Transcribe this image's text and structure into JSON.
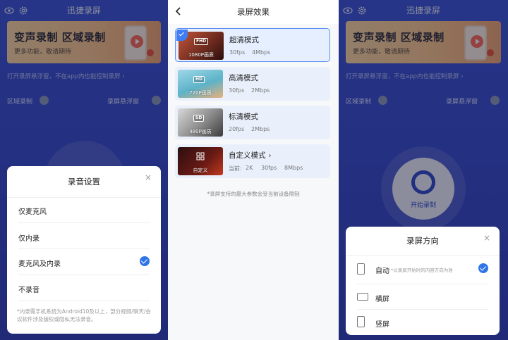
{
  "app": {
    "title": "迅捷录屏",
    "banner_title": "变声录制 区域录制",
    "banner_sub": "更多功能，敬请期待",
    "float_hint": "打开录屏悬浮窗，不在app内也能控制录屏 ›",
    "area_record_label": "区域录制",
    "float_window_label": "录屏悬浮窗",
    "start_record_label": "开始录制"
  },
  "audio_sheet": {
    "title": "录音设置",
    "options": [
      {
        "label": "仅麦克风",
        "selected": false
      },
      {
        "label": "仅内录",
        "selected": false
      },
      {
        "label": "麦克风及内录",
        "selected": true
      },
      {
        "label": "不录音",
        "selected": false
      }
    ],
    "note": "*内录需手机系统为Android10及以上，部分视频/聊天/会议软件涉及版权或隐私无法录音。"
  },
  "quality": {
    "title": "录屏效果",
    "modes": [
      {
        "name": "超清模式",
        "badge": "FHD",
        "caption": "1080P画质",
        "fps": "30fps",
        "bitrate": "4Mbps",
        "selected": true
      },
      {
        "name": "高清模式",
        "badge": "HD",
        "caption": "720P画质",
        "fps": "30fps",
        "bitrate": "2Mbps",
        "selected": false
      },
      {
        "name": "标清模式",
        "badge": "SD",
        "caption": "480P画质",
        "fps": "20fps",
        "bitrate": "2Mbps",
        "selected": false
      }
    ],
    "custom": {
      "name": "自定义模式",
      "caption": "自定义",
      "current_label": "当前:",
      "resolution": "2K",
      "fps": "30fps",
      "bitrate": "8Mbps"
    },
    "note": "*录屏支持的最大参数会受当前设备限制"
  },
  "orientation_sheet": {
    "title": "录屏方向",
    "options": [
      {
        "label": "自动",
        "hint": "*以录屏开始时的内容方向为准",
        "selected": true
      },
      {
        "label": "横屏",
        "hint": "",
        "selected": false
      },
      {
        "label": "竖屏",
        "hint": "",
        "selected": false
      }
    ]
  },
  "colors": {
    "accent": "#2f74e8",
    "app_blue": "#3a53d6"
  },
  "icons": {
    "close": "×",
    "back": "‹",
    "chevron": "›"
  }
}
